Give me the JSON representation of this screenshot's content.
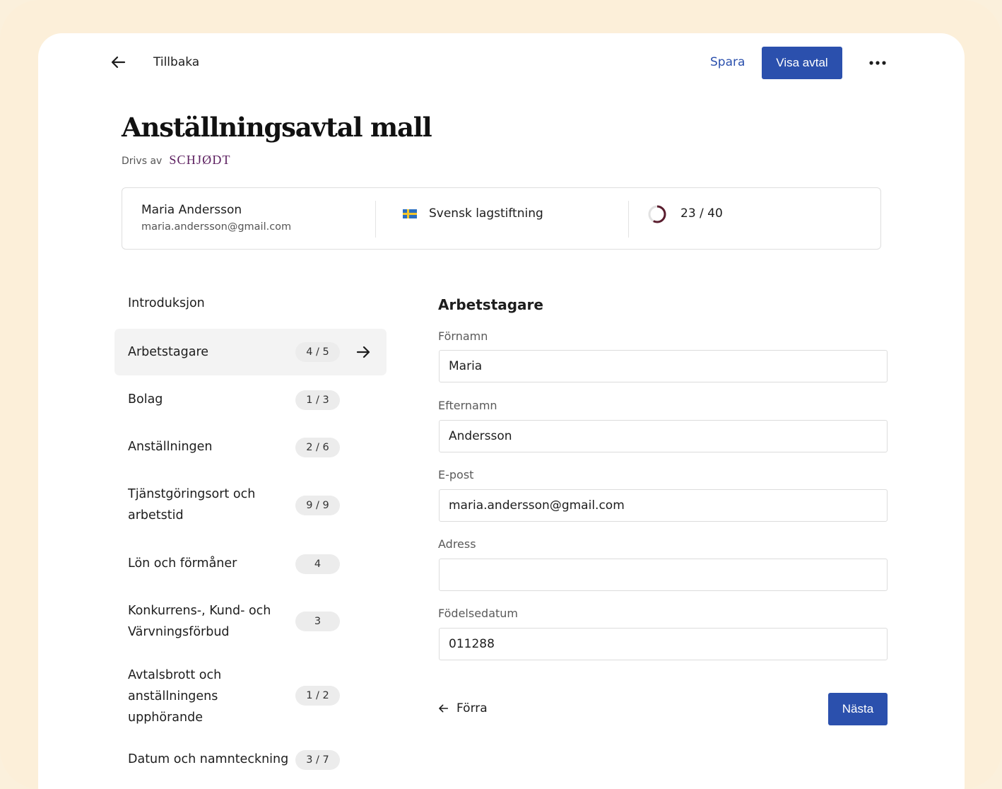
{
  "topbar": {
    "back_label": "Tillbaka",
    "save_label": "Spara",
    "primary_label": "Visa avtal"
  },
  "title": "Anställningsavtal mall",
  "powered_by": {
    "prefix": "Drivs av",
    "brand": "SCHJØDT",
    "brand_color": "#5b1d5e"
  },
  "info": {
    "user_name": "Maria Andersson",
    "user_email": "maria.andersson@gmail.com",
    "jurisdiction": "Svensk lagstiftning",
    "flag_icon": "sweden-flag-icon",
    "progress_text": "23 / 40",
    "progress_fraction": 0.575
  },
  "nav": {
    "intro": "Introduksjon",
    "items": [
      {
        "label": "Arbetstagare",
        "badge": "4 / 5",
        "active": true
      },
      {
        "label": "Bolag",
        "badge": "1 / 3"
      },
      {
        "label": "Anställningen",
        "badge": "2 / 6"
      },
      {
        "label": "Tjänstgöringsort och arbetstid",
        "badge": "9 / 9"
      },
      {
        "label": "Lön och förmåner",
        "badge": "4"
      },
      {
        "label": "Konkurrens-, Kund- och Värvningsförbud",
        "badge": "3"
      },
      {
        "label": "Avtalsbrott och anställningens upphörande",
        "badge": "1 / 2"
      },
      {
        "label": "Datum och namnteckning",
        "badge": "3 / 7"
      }
    ]
  },
  "form": {
    "title": "Arbetstagare",
    "fields": [
      {
        "label": "Förnamn",
        "value": "Maria"
      },
      {
        "label": "Efternamn",
        "value": "Andersson"
      },
      {
        "label": "E-post",
        "value": "maria.andersson@gmail.com"
      },
      {
        "label": "Adress",
        "value": ""
      },
      {
        "label": "Födelsedatum",
        "value": "011288"
      }
    ],
    "prev_label": "Förra",
    "next_label": "Nästa"
  },
  "colors": {
    "accent": "#2b50ad",
    "background": "#fcefd9",
    "progress_ring": "#5a1d2e"
  }
}
